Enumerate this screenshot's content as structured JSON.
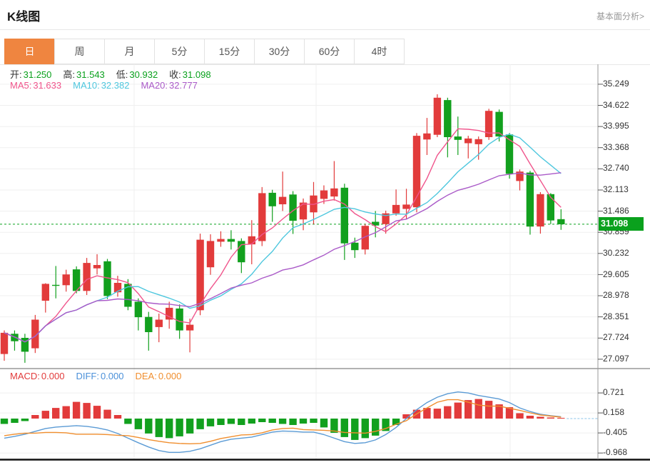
{
  "header": {
    "title": "K线图",
    "link": "基本面分析>"
  },
  "tabs": {
    "items": [
      "日",
      "周",
      "月",
      "5分",
      "15分",
      "30分",
      "60分",
      "4时"
    ],
    "active_index": 0
  },
  "info": {
    "open_label": "开:",
    "open": "31.250",
    "high_label": "高:",
    "high": "31.543",
    "low_label": "低:",
    "low": "30.932",
    "close_label": "收:",
    "close": "31.098"
  },
  "ma": {
    "ma5_label": "MA5:",
    "ma5": "31.633",
    "ma10_label": "MA10:",
    "ma10": "32.382",
    "ma20_label": "MA20:",
    "ma20": "32.777"
  },
  "macd_info": {
    "macd_label": "MACD:",
    "macd": "0.000",
    "diff_label": "DIFF:",
    "diff": "0.000",
    "dea_label": "DEA:",
    "dea": "0.000"
  },
  "price_badge": "31.098",
  "y_axis": {
    "labels": [
      "35.249",
      "34.622",
      "33.995",
      "33.368",
      "32.740",
      "32.113",
      "31.486",
      "30.859",
      "30.232",
      "29.605",
      "28.978",
      "28.351",
      "27.724",
      "27.097"
    ]
  },
  "macd_axis": {
    "labels": [
      "0.721",
      "0.158",
      "-0.405",
      "-0.968"
    ]
  },
  "colors": {
    "up": "#e23b3b",
    "down": "#12a01e",
    "badge": "#0aa11d",
    "accent": "#ef8540",
    "ma5": "#f0558c",
    "ma10": "#4ec7de",
    "ma20": "#aa5ac8",
    "diff": "#5b9bd5",
    "dea": "#f08e2e",
    "grid": "#efefef",
    "axis": "#999999"
  },
  "chart_data": {
    "type": "candlestick",
    "title": "K线图",
    "y_range": [
      26.84,
      35.84
    ],
    "y_ticks": [
      35.249,
      34.622,
      33.995,
      33.368,
      32.74,
      32.113,
      31.486,
      30.859,
      30.232,
      29.605,
      28.978,
      28.351,
      27.724,
      27.097
    ],
    "last_price": 31.098,
    "last_price_line": true,
    "grid": true,
    "v_gridlines_x": [
      188,
      443,
      715
    ],
    "ma_periods": [
      5,
      10,
      20
    ],
    "candles": [
      [
        27.25,
        27.95,
        27.05,
        27.88
      ],
      [
        27.85,
        27.95,
        27.35,
        27.63
      ],
      [
        27.73,
        27.85,
        26.99,
        27.32
      ],
      [
        27.42,
        28.41,
        27.28,
        28.27
      ],
      [
        28.83,
        29.35,
        28.48,
        29.33
      ],
      [
        29.3,
        29.86,
        28.9,
        29.28
      ],
      [
        29.29,
        29.75,
        29.1,
        29.61
      ],
      [
        29.76,
        29.85,
        29.05,
        29.12
      ],
      [
        29.12,
        30.1,
        29.0,
        29.95
      ],
      [
        29.79,
        30.21,
        29.61,
        29.89
      ],
      [
        30.0,
        30.07,
        28.88,
        28.97
      ],
      [
        29.08,
        29.57,
        28.95,
        29.36
      ],
      [
        29.33,
        29.47,
        28.55,
        28.65
      ],
      [
        28.8,
        28.9,
        27.95,
        28.34
      ],
      [
        28.35,
        28.5,
        27.35,
        27.9
      ],
      [
        28.05,
        28.45,
        27.6,
        28.27
      ],
      [
        28.27,
        28.8,
        28.0,
        28.62
      ],
      [
        28.6,
        28.72,
        27.7,
        27.95
      ],
      [
        27.95,
        28.3,
        27.3,
        28.12
      ],
      [
        28.55,
        30.82,
        28.4,
        30.64
      ],
      [
        29.82,
        30.8,
        29.6,
        30.6
      ],
      [
        30.58,
        30.89,
        30.43,
        30.66
      ],
      [
        30.66,
        30.92,
        30.35,
        30.58
      ],
      [
        30.6,
        30.68,
        29.65,
        29.97
      ],
      [
        30.5,
        31.22,
        29.91,
        30.74
      ],
      [
        30.6,
        32.2,
        30.45,
        32.02
      ],
      [
        32.03,
        32.12,
        31.17,
        31.63
      ],
      [
        31.69,
        32.66,
        31.49,
        31.91
      ],
      [
        31.98,
        32.08,
        30.81,
        31.2
      ],
      [
        31.24,
        31.86,
        30.92,
        31.74
      ],
      [
        31.45,
        32.35,
        31.1,
        31.95
      ],
      [
        31.85,
        32.25,
        31.7,
        32.1
      ],
      [
        31.92,
        32.97,
        31.8,
        32.16
      ],
      [
        32.18,
        32.3,
        30.04,
        30.53
      ],
      [
        30.55,
        30.7,
        30.1,
        30.33
      ],
      [
        30.35,
        31.1,
        30.2,
        31.05
      ],
      [
        31.17,
        31.49,
        30.71,
        31.06
      ],
      [
        31.1,
        31.5,
        30.82,
        31.42
      ],
      [
        31.42,
        32.13,
        31.35,
        31.67
      ],
      [
        31.55,
        32.15,
        31.25,
        31.68
      ],
      [
        31.6,
        33.8,
        31.45,
        33.72
      ],
      [
        33.61,
        34.25,
        33.15,
        33.79
      ],
      [
        33.75,
        34.95,
        33.68,
        34.85
      ],
      [
        34.78,
        34.85,
        33.08,
        33.68
      ],
      [
        33.7,
        34.29,
        33.15,
        33.6
      ],
      [
        33.5,
        33.72,
        33.05,
        33.64
      ],
      [
        33.47,
        33.7,
        33.01,
        33.62
      ],
      [
        33.68,
        34.52,
        33.6,
        34.46
      ],
      [
        34.43,
        34.5,
        33.55,
        33.7
      ],
      [
        33.76,
        33.8,
        32.45,
        32.59
      ],
      [
        32.38,
        32.72,
        32.1,
        32.66
      ],
      [
        32.63,
        32.68,
        30.79,
        31.03
      ],
      [
        31.03,
        32.05,
        30.82,
        31.99
      ],
      [
        31.99,
        32.02,
        31.1,
        31.21
      ],
      [
        31.25,
        31.543,
        30.932,
        31.098
      ]
    ],
    "macd_panel": {
      "range": [
        -1.19,
        0.885
      ],
      "ticks": [
        0.721,
        0.158,
        -0.405,
        -0.968
      ],
      "hist": [
        -0.15,
        -0.12,
        -0.07,
        0.1,
        0.22,
        0.3,
        0.35,
        0.47,
        0.44,
        0.36,
        0.25,
        0.1,
        -0.15,
        -0.3,
        -0.42,
        -0.52,
        -0.55,
        -0.5,
        -0.42,
        -0.3,
        -0.22,
        -0.18,
        -0.15,
        -0.18,
        -0.14,
        -0.1,
        -0.12,
        -0.15,
        -0.18,
        -0.14,
        -0.12,
        -0.25,
        -0.4,
        -0.52,
        -0.6,
        -0.55,
        -0.48,
        -0.35,
        -0.18,
        0.12,
        0.25,
        0.3,
        0.28,
        0.35,
        0.45,
        0.52,
        0.55,
        0.5,
        0.4,
        0.32,
        0.15,
        0.08,
        0.05,
        0.03,
        0.02
      ],
      "diff": [
        -0.55,
        -0.5,
        -0.44,
        -0.36,
        -0.28,
        -0.24,
        -0.22,
        -0.2,
        -0.22,
        -0.26,
        -0.32,
        -0.42,
        -0.55,
        -0.68,
        -0.8,
        -0.9,
        -0.95,
        -0.95,
        -0.92,
        -0.85,
        -0.75,
        -0.65,
        -0.58,
        -0.55,
        -0.52,
        -0.45,
        -0.38,
        -0.35,
        -0.36,
        -0.38,
        -0.38,
        -0.45,
        -0.55,
        -0.65,
        -0.7,
        -0.68,
        -0.6,
        -0.45,
        -0.25,
        0.0,
        0.25,
        0.45,
        0.6,
        0.7,
        0.75,
        0.72,
        0.65,
        0.6,
        0.55,
        0.45,
        0.3,
        0.2,
        0.12,
        0.08,
        0.05
      ],
      "dea": [
        -0.48,
        -0.44,
        -0.41,
        -0.41,
        -0.39,
        -0.39,
        -0.4,
        -0.44,
        -0.44,
        -0.44,
        -0.45,
        -0.47,
        -0.48,
        -0.53,
        -0.59,
        -0.64,
        -0.68,
        -0.7,
        -0.71,
        -0.7,
        -0.64,
        -0.56,
        -0.51,
        -0.46,
        -0.45,
        -0.4,
        -0.32,
        -0.28,
        -0.27,
        -0.31,
        -0.32,
        -0.33,
        -0.35,
        -0.39,
        -0.4,
        -0.41,
        -0.36,
        -0.28,
        -0.16,
        -0.06,
        0.13,
        0.3,
        0.46,
        0.53,
        0.53,
        0.46,
        0.38,
        0.35,
        0.35,
        0.29,
        0.23,
        0.16,
        0.1,
        0.07,
        0.04
      ]
    }
  }
}
